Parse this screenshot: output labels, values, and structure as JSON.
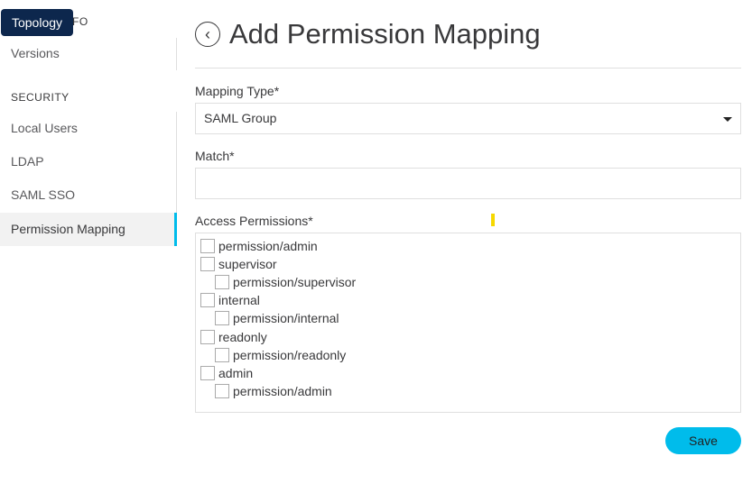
{
  "sidebar": {
    "info_header_partial": "FO",
    "versions": "Versions",
    "security_header": "SECURITY",
    "items": [
      {
        "label": "Local Users"
      },
      {
        "label": "LDAP"
      },
      {
        "label": "SAML SSO"
      },
      {
        "label": "Permission Mapping",
        "active": true
      }
    ]
  },
  "tooltip": "Topology",
  "page": {
    "title": "Add Permission Mapping"
  },
  "form": {
    "mapping_type_label": "Mapping Type*",
    "mapping_type_value": "SAML Group",
    "match_label": "Match*",
    "match_value": "",
    "access_label": "Access Permissions*",
    "permissions": [
      {
        "label": "permission/admin",
        "level": 0
      },
      {
        "label": "supervisor",
        "level": 0
      },
      {
        "label": "permission/supervisor",
        "level": 1
      },
      {
        "label": "internal",
        "level": 0
      },
      {
        "label": "permission/internal",
        "level": 1
      },
      {
        "label": "readonly",
        "level": 0
      },
      {
        "label": "permission/readonly",
        "level": 1
      },
      {
        "label": "admin",
        "level": 0
      },
      {
        "label": "permission/admin",
        "level": 1
      }
    ],
    "save": "Save"
  },
  "colors": {
    "accent": "#00bceb",
    "tooltip": "#0d274d"
  }
}
